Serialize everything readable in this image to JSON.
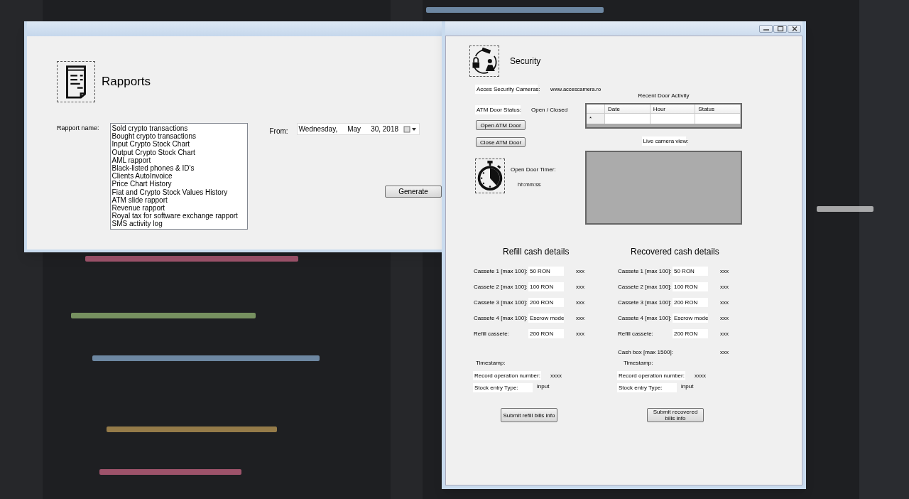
{
  "rapports_window": {
    "title": "Rapports",
    "rapport_name_label": "Rapport name:",
    "rapports": [
      "Sold crypto transactions",
      "Bought crypto transactions",
      "Input Crypto Stock Chart",
      "Output Crypto Stock Chart",
      "AML rapport",
      "Black-listed phones & ID's",
      "Clients AutoInvoice",
      "Price Chart History",
      "Fiat and Crypto Stock Values History",
      "ATM slide rapport",
      "Revenue rapport",
      "Royal tax for software exchange rapport",
      "SMS activity log"
    ],
    "from_label": "From:",
    "date": {
      "weekday": "Wednesday,",
      "month": "May",
      "day_year": "30, 2018"
    },
    "generate_button": "Generate"
  },
  "security_window": {
    "title": "Security",
    "cameras_label": "Acces Security Cameras:",
    "cameras_url": "www.accescamera.ro",
    "door_status_label": "ATM Door Status:",
    "door_status": "Open / Closed",
    "open_button": "Open ATM Door",
    "close_button": "Close ATM Door",
    "timer_label": "Open Door Timer:",
    "timer": "hh:mm:ss",
    "activity": {
      "title": "Recent Door Activity",
      "columns": [
        "Date",
        "Hour",
        "Status"
      ],
      "new_row_marker": "*"
    },
    "camera_label": "Live camera view:",
    "panels": [
      {
        "title": "Refill cash details",
        "rows": [
          {
            "label": "Cassete 1 [max 100]:",
            "value": "50 RON",
            "reading": "xxx"
          },
          {
            "label": "Cassete 2 [max 100]:",
            "value": "100 RON",
            "reading": "xxx"
          },
          {
            "label": "Cassete 3 [max 100]:",
            "value": "200 RON",
            "reading": "xxx"
          },
          {
            "label": "Cassete 4 [max 100]:",
            "value": "Escrow mode",
            "reading": "xxx"
          },
          {
            "label": "Refill cassete:",
            "value": "200 RON",
            "reading": "xxx"
          }
        ],
        "timestamp_label": "Timestamp:",
        "record_label": "Record operation number:",
        "record_value": "xxxx",
        "stock_label": "Stock entry Type:",
        "stock_value": "input",
        "submit_button": "Submit refill bills info"
      },
      {
        "title": "Recovered cash details",
        "rows": [
          {
            "label": "Cassete 1 [max 100]:",
            "value": "50 RON",
            "reading": "xxx"
          },
          {
            "label": "Cassete 2 [max 100]:",
            "value": "100 RON",
            "reading": "xxx"
          },
          {
            "label": "Cassete 3 [max 100]:",
            "value": "200 RON",
            "reading": "xxx"
          },
          {
            "label": "Cassete 4 [max 100]:",
            "value": "Escrow mode",
            "reading": "xxx"
          },
          {
            "label": "Refill cassete:",
            "value": "200 RON",
            "reading": "xxx"
          },
          {
            "label": "Cash box [max 1500]:",
            "reading": "xxx"
          }
        ],
        "timestamp_label": "Timestamp:",
        "record_label": "Record operation number:",
        "record_value": "xxxx",
        "stock_label": "Stock entry Type:",
        "stock_value": "input",
        "submit_button": "Submit recovered bills info"
      }
    ]
  }
}
